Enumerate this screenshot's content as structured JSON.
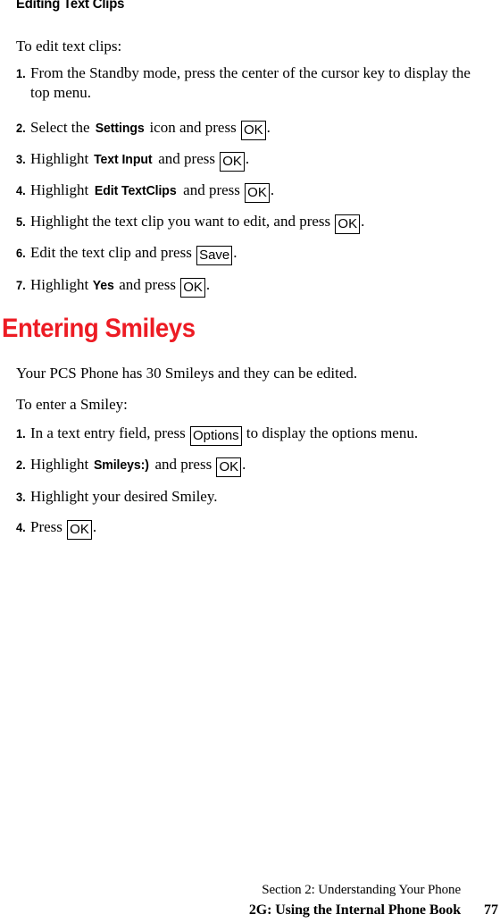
{
  "page": {
    "background": "#ffffff",
    "accent_color": "#ED1C24",
    "text_color": "#000000"
  },
  "section_heading": {
    "label": "Editing Text Clips"
  },
  "editing_text_clips": {
    "intro": "To edit text clips:",
    "steps": [
      {
        "number": "1.",
        "pre": "From the Standby mode, press the center of the cursor key to display the top menu.",
        "term": "",
        "mid": "",
        "key": "",
        "post": ""
      },
      {
        "number": "2.",
        "pre": "Select the ",
        "term": "Settings",
        "mid": " icon and press ",
        "key": "OK",
        "post": "."
      },
      {
        "number": "3.",
        "pre": "Highlight ",
        "term": "Text Input",
        "mid": " and press ",
        "key": "OK",
        "post": "."
      },
      {
        "number": "4.",
        "pre": "Highlight ",
        "term": "Edit TextClips",
        "mid": " and press ",
        "key": "OK",
        "post": "."
      },
      {
        "number": "5.",
        "pre": "Highlight the text clip you want to edit, and press ",
        "term": "",
        "mid": "",
        "key": "OK",
        "post": "."
      },
      {
        "number": "6.",
        "pre": "Edit the text clip and press ",
        "term": "",
        "mid": "",
        "key": "Save",
        "post": "."
      },
      {
        "number": "7.",
        "pre": "Highlight ",
        "term": "Yes",
        "mid": " and press ",
        "key": "OK",
        "post": "."
      }
    ]
  },
  "entering_smileys": {
    "heading": "Entering Smileys",
    "description": "Your PCS Phone has 30 Smileys and they can be edited.",
    "intro": "To enter a Smiley:",
    "steps": [
      {
        "number": "1.",
        "pre": "In a text entry field, press ",
        "term": "",
        "mid": "",
        "key": "Options",
        "post": " to display the options menu."
      },
      {
        "number": "2.",
        "pre": "Highlight ",
        "term": "Smileys:)",
        "mid": " and press ",
        "key": "OK",
        "post": "."
      },
      {
        "number": "3.",
        "pre": "Highlight your desired Smiley.",
        "term": "",
        "mid": "",
        "key": "",
        "post": ""
      },
      {
        "number": "4.",
        "pre": "Press ",
        "term": "",
        "mid": "",
        "key": "OK",
        "post": "."
      }
    ]
  },
  "footer": {
    "section_line": "Section 2: Understanding Your Phone",
    "chapter_line": "2G: Using the Internal Phone Book",
    "page_number": "77"
  }
}
